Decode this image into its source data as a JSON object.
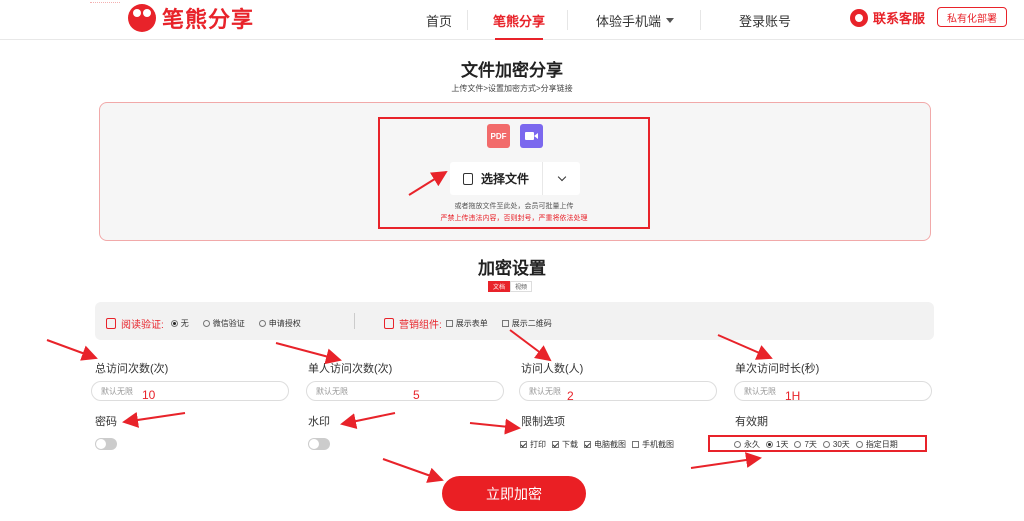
{
  "header": {
    "logo_text": "笔熊分享",
    "nav": [
      {
        "label": "首页"
      },
      {
        "label": "笔熊分享"
      },
      {
        "label": "体验手机端"
      },
      {
        "label": "登录账号"
      }
    ],
    "service_label": "联系客服",
    "private_label": "私有化部署"
  },
  "page_title": "文件加密分享",
  "steps": "上传文件>设置加密方式>分享链接",
  "upload": {
    "pdf_icon": "PDF",
    "choose_label": "选择文件",
    "hint": "或者拖放文件至此处，会员可批量上传",
    "warning": "严禁上传违法内容，否则封号，严重将依法处理"
  },
  "settings": {
    "title": "加密设置",
    "tabs": [
      "文档",
      "视频"
    ],
    "read_verify_label": "阅读验证:",
    "read_verify_options": [
      {
        "label": "无",
        "selected": true
      },
      {
        "label": "微信验证",
        "selected": false
      },
      {
        "label": "申请授权",
        "selected": false
      }
    ],
    "marketing_label": "营销组件:",
    "marketing_options": [
      {
        "label": "展示表单",
        "checked": false
      },
      {
        "label": "展示二维码",
        "checked": false
      }
    ]
  },
  "fields": {
    "total_visits": {
      "label": "总访问次数(次)",
      "placeholder": "默认无限",
      "annotation": "10"
    },
    "per_person_visits": {
      "label": "单人访问次数(次)",
      "placeholder": "默认无限",
      "annotation": "5"
    },
    "visitors": {
      "label": "访问人数(人)",
      "placeholder": "默认无限",
      "annotation": "2"
    },
    "visit_duration": {
      "label": "单次访问时长(秒)",
      "placeholder": "默认无限",
      "annotation": "1H"
    }
  },
  "password_label": "密码",
  "watermark_label": "水印",
  "restrictions": {
    "label": "限制选项",
    "options": [
      {
        "label": "打印",
        "checked": true
      },
      {
        "label": "下载",
        "checked": true
      },
      {
        "label": "电脑截图",
        "checked": true
      },
      {
        "label": "手机截图",
        "checked": false
      }
    ]
  },
  "validity": {
    "label": "有效期",
    "options": [
      {
        "label": "永久",
        "selected": false
      },
      {
        "label": "1天",
        "selected": true
      },
      {
        "label": "7天",
        "selected": false
      },
      {
        "label": "30天",
        "selected": false
      },
      {
        "label": "指定日期",
        "selected": false
      }
    ]
  },
  "submit_label": "立即加密",
  "colors": {
    "accent": "#e8232a",
    "upload_bg": "#f6f6f6"
  }
}
